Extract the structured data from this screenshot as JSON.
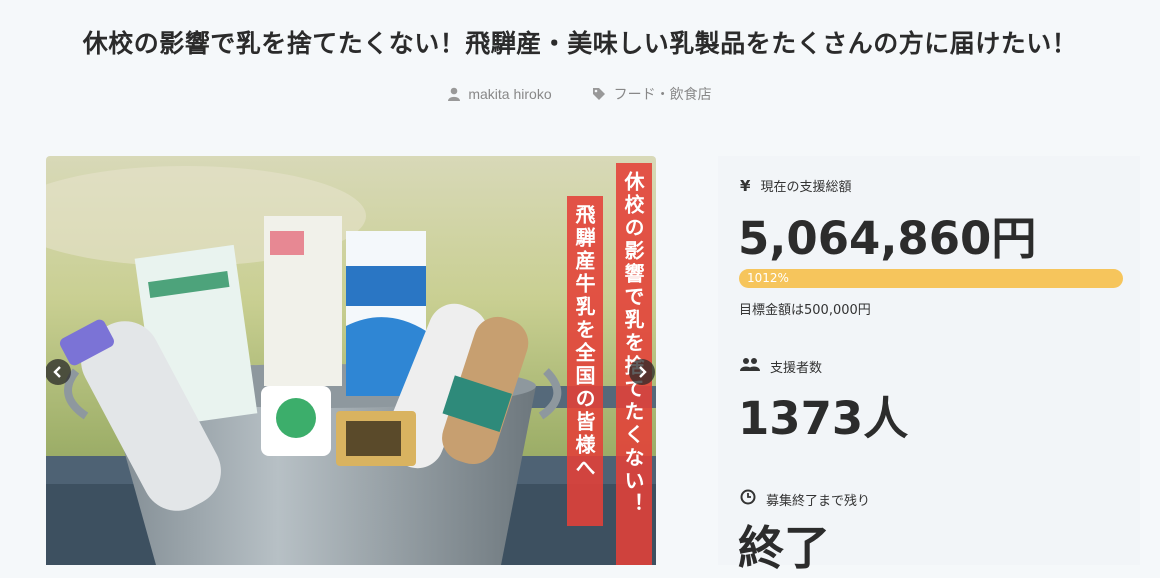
{
  "project": {
    "title": "休校の影響で乳を捨てたくない！飛騨産・美味しい乳製品をたくさんの方に届けたい！",
    "author": "makita hiroko",
    "category": "フード・飲食店"
  },
  "hero": {
    "banner_right": "休校の影響で乳を捨てたくない！",
    "banner_left": "飛騨産牛乳を全国の皆様へ"
  },
  "stats": {
    "total_label": "現在の支援総額",
    "total_value": "5,064,860円",
    "progress_percent": 1012,
    "progress_text": "1012%",
    "goal_text": "目標金額は500,000円",
    "backers_label": "支援者数",
    "backers_value": "1373人",
    "remaining_label": "募集終了まで残り",
    "remaining_value": "終了"
  },
  "colors": {
    "accent": "#f6c55c",
    "banner": "#e44038"
  }
}
